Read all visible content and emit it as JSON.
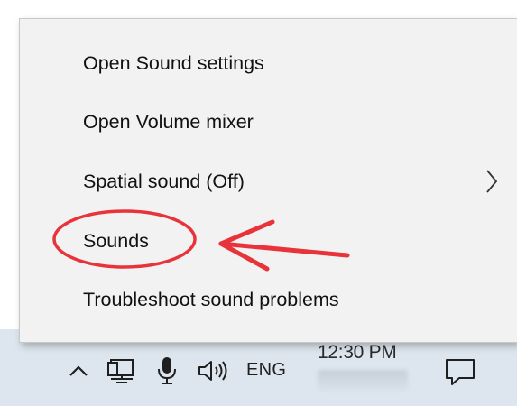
{
  "context_menu": {
    "items": [
      {
        "label": "Open Sound settings"
      },
      {
        "label": "Open Volume mixer"
      },
      {
        "label": "Spatial sound (Off)",
        "submenu": true
      },
      {
        "label": "Sounds",
        "highlighted_by_annotation": true
      },
      {
        "label": "Troubleshoot sound problems"
      }
    ]
  },
  "taskbar": {
    "language": "ENG",
    "clock_time": "12:30 PM",
    "icons": [
      "chevron-up-icon",
      "network-icon",
      "microphone-icon",
      "volume-icon",
      "action-center-icon"
    ]
  },
  "annotation": {
    "color": "#e8333a"
  }
}
